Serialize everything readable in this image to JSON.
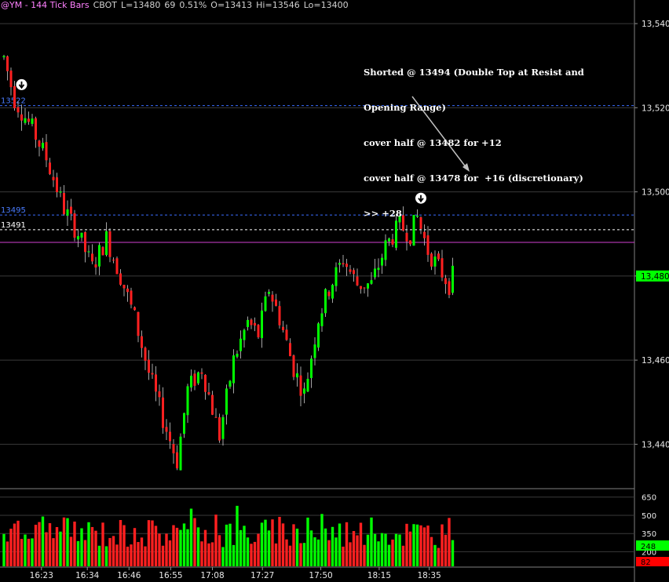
{
  "header": {
    "symbol": "@YM - 144 Tick Bars",
    "exchange": "CBOT",
    "last": "L=13480",
    "change": "69",
    "change_pct": "0.51%",
    "open": "O=13413",
    "high": "Hi=13546",
    "low": "Lo=13400"
  },
  "annotation": {
    "lines": [
      "Shorted @ 13494 (Double Top at Resist and",
      "Opening Range)",
      "cover half @ 13482 for +12",
      "cover half @ 13478 for  +16 (discretionary)",
      ">> +28"
    ]
  },
  "colors": {
    "up": "#00ff00",
    "down": "#ff2020",
    "background": "#000000",
    "resistance_line": "#3a6cff",
    "opening_range_line": "#ffffff",
    "magenta_line": "#d040d0",
    "current_price_tag": "#00ff00",
    "volume_tag": "#00ff00",
    "volume_tag_down": "#ff0000"
  },
  "chart_data": {
    "type": "candlestick",
    "price_axis": {
      "ticks": [
        "13,540",
        "13,520",
        "13,500",
        "13,480",
        "13,460",
        "13,440"
      ],
      "tick_values": [
        13540,
        13520,
        13500,
        13480,
        13460,
        13440
      ],
      "ylim": [
        13430,
        13543
      ],
      "current_price_label": "13,480",
      "current_price": 13480
    },
    "time_axis": {
      "ticks": [
        "16:23",
        "16:34",
        "16:46",
        "16:55",
        "17:08",
        "17:27",
        "17:50",
        "18:15",
        "18:35"
      ],
      "tick_index": [
        9,
        20,
        30,
        40,
        50,
        62,
        76,
        90,
        102
      ],
      "bar_count": 110
    },
    "lines": [
      {
        "label": "13522",
        "value": 13520.5,
        "style": "dashed",
        "color": "blue"
      },
      {
        "label": "13495",
        "value": 13494.5,
        "style": "dashed",
        "color": "blue"
      },
      {
        "label": "13491",
        "value": 13491,
        "style": "dashed",
        "color": "white"
      },
      {
        "label": "",
        "value": 13488,
        "style": "solid",
        "color": "magenta"
      }
    ],
    "close_path": [
      [
        0,
        13532
      ],
      [
        3,
        13522
      ],
      [
        8,
        13515
      ],
      [
        12,
        13508
      ],
      [
        17,
        13496
      ],
      [
        21,
        13490
      ],
      [
        25,
        13482
      ],
      [
        29,
        13489
      ],
      [
        33,
        13480
      ],
      [
        37,
        13470
      ],
      [
        41,
        13457
      ],
      [
        45,
        13446
      ],
      [
        49,
        13436
      ],
      [
        52,
        13453
      ],
      [
        56,
        13458
      ],
      [
        61,
        13442
      ],
      [
        65,
        13460
      ],
      [
        69,
        13469
      ],
      [
        72,
        13466
      ],
      [
        75,
        13477
      ],
      [
        78,
        13470
      ],
      [
        82,
        13458
      ],
      [
        85,
        13452
      ],
      [
        89,
        13470
      ],
      [
        92,
        13477
      ],
      [
        96,
        13484
      ],
      [
        100,
        13478
      ],
      [
        104,
        13478
      ],
      [
        108,
        13487
      ],
      [
        112,
        13492
      ],
      [
        115,
        13490
      ],
      [
        117,
        13494
      ],
      [
        120,
        13486
      ],
      [
        123,
        13482
      ],
      [
        126,
        13478
      ],
      [
        127,
        13480
      ]
    ],
    "signals": [
      {
        "type": "short-arrow",
        "bar": 5,
        "price": 13524
      },
      {
        "type": "short-arrow",
        "bar": 118,
        "price": 13497
      }
    ],
    "volume": {
      "ticks": [
        "650",
        "500",
        "350",
        "200"
      ],
      "tick_values": [
        650,
        500,
        350,
        200
      ],
      "ylim": [
        80,
        700
      ],
      "current_up": "248",
      "current_down": "82",
      "current_up_value": 248,
      "current_down_value": 82
    }
  }
}
